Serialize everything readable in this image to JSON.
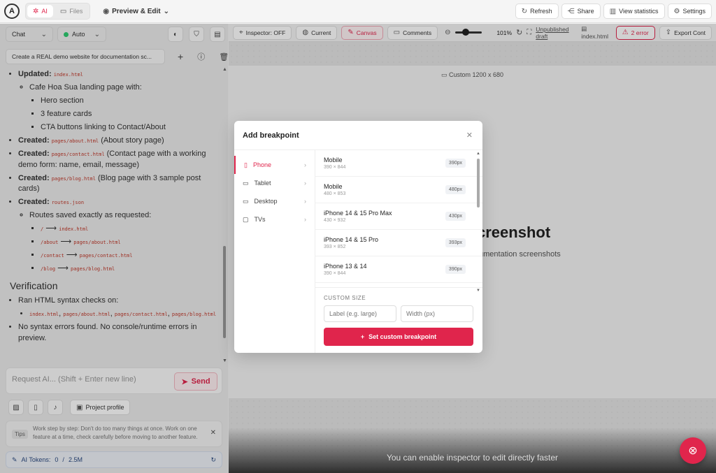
{
  "topbar": {
    "logo": "A",
    "ai_tab": "AI",
    "files_tab": "Files",
    "mode": "Preview & Edit",
    "refresh": "Refresh",
    "share": "Share",
    "view_stats": "View statistics",
    "settings": "Settings"
  },
  "sidebar": {
    "chat_select": "Chat",
    "model_select": "Auto",
    "task_title": "Create a REAL demo website for documentation sc...",
    "request_placeholder": "Request AI... (Shift + Enter new line)",
    "send": "Send",
    "project_profile": "Project profile",
    "tips_label": "Tips",
    "tips_text": "Work step by step: Don't do too many things at once. Work on one feature at a time, check carefully before moving to another feature.",
    "tokens_label": "AI Tokens:",
    "tokens_used": "0",
    "tokens_sep": "/",
    "tokens_total": "2.5M"
  },
  "chat": {
    "updated_label": "Updated:",
    "updated_file": "index.html",
    "cafe_line": "Cafe Hoa Sua landing page with:",
    "hero": "Hero section",
    "features": "3 feature cards",
    "cta": "CTA buttons linking to Contact/About",
    "created_label": "Created:",
    "about_file": "pages/about.html",
    "about_desc": "(About story page)",
    "contact_file": "pages/contact.html",
    "contact_desc": "(Contact page with a working demo form: name, email, message)",
    "blog_file": "pages/blog.html",
    "blog_desc": "(Blog page with 3 sample post cards)",
    "routes_file": "routes.json",
    "routes_saved": "Routes saved exactly as requested:",
    "r1_from": "/",
    "r1_to": "index.html",
    "r2_from": "/about",
    "r2_to": "pages/about.html",
    "r3_from": "/contact",
    "r3_to": "pages/contact.html",
    "r4_from": "/blog",
    "r4_to": "pages/blog.html",
    "arrow": "⟶",
    "verification": "Verification",
    "ran_checks": "Ran HTML syntax checks on:",
    "check_file_1": "index.html",
    "check_file_2": "pages/about.html",
    "check_file_3": "pages/contact.html",
    "check_file_4": "pages/blog.html",
    "no_errors": "No syntax errors found. No console/runtime errors in preview."
  },
  "toolbar": {
    "inspector": "Inspector: OFF",
    "current": "Current",
    "canvas": "Canvas",
    "comments": "Comments",
    "zoom": "101%",
    "unpublished": "Unpublished draft",
    "file": "index.html",
    "errors": "2 error",
    "export": "Export Cont"
  },
  "preview": {
    "size_label": "Custom 1200 x 680",
    "heading_fragment": "creenshot",
    "sub_fragment": "umentation screenshots",
    "hint": "You can enable inspector to edit directly faster"
  },
  "modal": {
    "title": "Add breakpoint",
    "categories": [
      {
        "label": "Phone",
        "icon": "phone-icon"
      },
      {
        "label": "Tablet",
        "icon": "tablet-icon"
      },
      {
        "label": "Desktop",
        "icon": "desktop-icon"
      },
      {
        "label": "TVs",
        "icon": "tv-icon"
      }
    ],
    "devices": [
      {
        "name": "Mobile",
        "size": "390 × 844",
        "badge": "390px"
      },
      {
        "name": "Mobile",
        "size": "480 × 853",
        "badge": "480px"
      },
      {
        "name": "iPhone 14 & 15 Pro Max",
        "size": "430 × 932",
        "badge": "430px"
      },
      {
        "name": "iPhone 14 & 15 Pro",
        "size": "393 × 852",
        "badge": "393px"
      },
      {
        "name": "iPhone 13 & 14",
        "size": "390 × 844",
        "badge": "390px"
      }
    ],
    "custom_size": "CUSTOM SIZE",
    "label_placeholder": "Label (e.g. large)",
    "width_placeholder": "Width (px)",
    "set_button": "Set custom breakpoint"
  },
  "colors": {
    "accent": "#e0254c"
  }
}
